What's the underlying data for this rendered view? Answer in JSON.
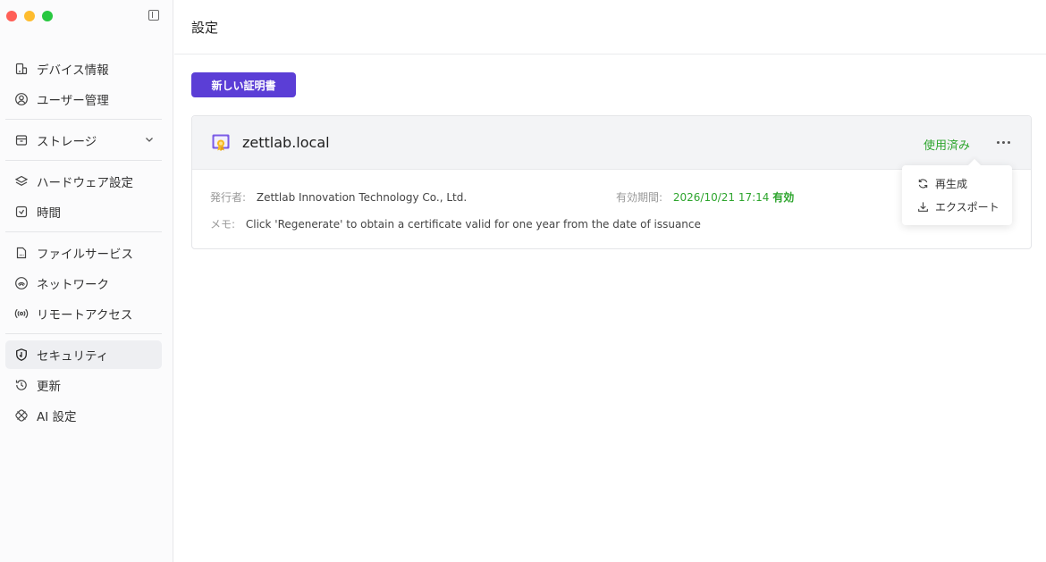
{
  "window": {
    "traffic_colors": [
      "#ff5f57",
      "#febc2e",
      "#28c840"
    ]
  },
  "sidebar": {
    "groups": [
      [
        {
          "label": "デバイス情報",
          "icon": "device-icon"
        },
        {
          "label": "ユーザー管理",
          "icon": "user-icon"
        }
      ],
      [
        {
          "label": "ストレージ",
          "icon": "storage-icon",
          "expandable": true
        }
      ],
      [
        {
          "label": "ハードウェア設定",
          "icon": "layers-icon"
        },
        {
          "label": "時間",
          "icon": "clock-icon"
        }
      ],
      [
        {
          "label": "ファイルサービス",
          "icon": "file-service-icon"
        },
        {
          "label": "ネットワーク",
          "icon": "network-icon"
        },
        {
          "label": "リモートアクセス",
          "icon": "remote-access-icon"
        }
      ],
      [
        {
          "label": "セキュリティ",
          "icon": "shield-icon",
          "active": true
        },
        {
          "label": "更新",
          "icon": "history-icon"
        },
        {
          "label": "AI 設定",
          "icon": "ai-icon"
        }
      ]
    ]
  },
  "header": {
    "title": "設定"
  },
  "main": {
    "new_cert_label": "新しい証明書",
    "certificate": {
      "domain": "zettlab.local",
      "status": "使用済み",
      "issuer_label": "発行者:",
      "issuer": "Zettlab Innovation Technology Co., Ltd.",
      "validity_label": "有効期間:",
      "validity_date": "2026/10/21 17:14",
      "validity_status": "有効",
      "memo_label": "メモ:",
      "memo": "Click 'Regenerate' to obtain a certificate valid for one year from the date of issuance"
    },
    "menu": {
      "regenerate": "再生成",
      "export": "エクスポート"
    }
  },
  "colors": {
    "accent": "#5b3ed6",
    "success": "#2ea52e"
  }
}
